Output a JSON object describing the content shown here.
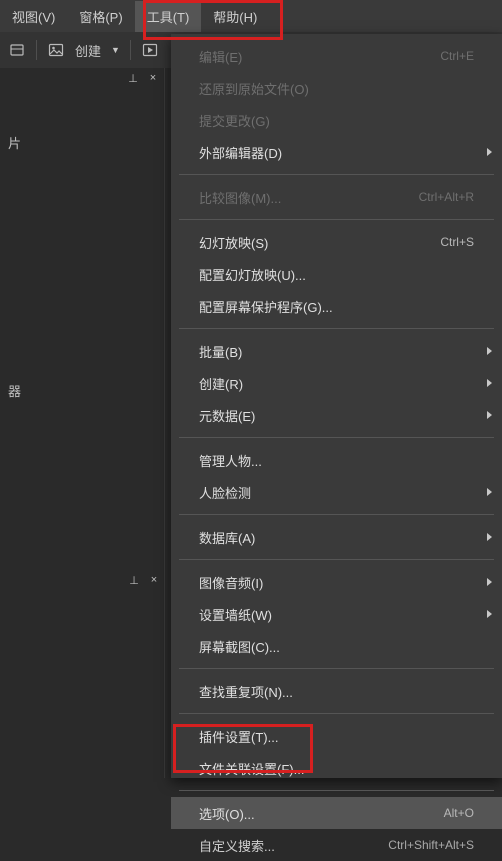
{
  "menubar": {
    "view": "视图(V)",
    "pane": "窗格(P)",
    "tools": "工具(T)",
    "help": "帮助(H)"
  },
  "toolbar": {
    "create": "创建"
  },
  "left": {
    "tab1": "片",
    "tab2": "器"
  },
  "menu": {
    "edit": {
      "label": "编辑(E)",
      "shortcut": "Ctrl+E"
    },
    "restore": {
      "label": "还原到原始文件(O)"
    },
    "commit": {
      "label": "提交更改(G)"
    },
    "external": {
      "label": "外部编辑器(D)"
    },
    "compare": {
      "label": "比较图像(M)...",
      "shortcut": "Ctrl+Alt+R"
    },
    "slideshow": {
      "label": "幻灯放映(S)",
      "shortcut": "Ctrl+S"
    },
    "config_slide": {
      "label": "配置幻灯放映(U)..."
    },
    "screensaver": {
      "label": "配置屏幕保护程序(G)..."
    },
    "batch": {
      "label": "批量(B)"
    },
    "create": {
      "label": "创建(R)"
    },
    "metadata": {
      "label": "元数据(E)"
    },
    "people": {
      "label": "管理人物..."
    },
    "face": {
      "label": "人脸检测"
    },
    "database": {
      "label": "数据库(A)"
    },
    "audio": {
      "label": "图像音频(I)"
    },
    "wallpaper": {
      "label": "设置墙纸(W)"
    },
    "screenshot": {
      "label": "屏幕截图(C)..."
    },
    "duplicate": {
      "label": "查找重复项(N)..."
    },
    "plugin": {
      "label": "插件设置(T)..."
    },
    "fileassoc": {
      "label": "文件关联设置(F)..."
    },
    "options": {
      "label": "选项(O)...",
      "shortcut": "Alt+O"
    },
    "custom": {
      "label": "自定义搜索...",
      "shortcut": "Ctrl+Shift+Alt+S"
    }
  }
}
